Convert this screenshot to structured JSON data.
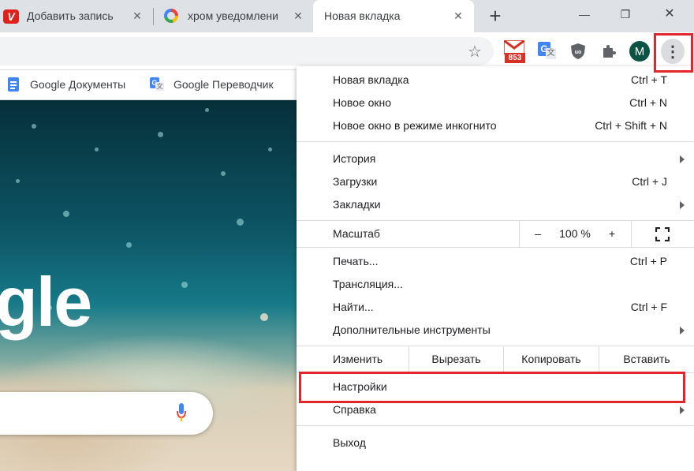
{
  "tabs": [
    {
      "title": "Добавить запись"
    },
    {
      "title": "хром уведомлени"
    },
    {
      "title": "Новая вкладка"
    }
  ],
  "new_tab_label": "+",
  "window_controls": {
    "minimize": "—",
    "maximize": "❐",
    "close": "✕"
  },
  "toolbar": {
    "gmail_badge": "853",
    "profile_initial": "M",
    "menu_icon": "⋮",
    "star_icon": "☆"
  },
  "bookmarks": [
    {
      "label": "Google Документы"
    },
    {
      "label": "Google Переводчик"
    }
  ],
  "page": {
    "logo_fragment": "gle"
  },
  "menu": {
    "group1": [
      {
        "label": "Новая вкладка",
        "shortcut": "Ctrl + T"
      },
      {
        "label": "Новое окно",
        "shortcut": "Ctrl + N"
      },
      {
        "label": "Новое окно в режиме инкогнито",
        "shortcut": "Ctrl + Shift + N"
      }
    ],
    "group2": [
      {
        "label": "История",
        "shortcut": ""
      },
      {
        "label": "Загрузки",
        "shortcut": "Ctrl + J"
      },
      {
        "label": "Закладки",
        "shortcut": ""
      }
    ],
    "zoom": {
      "label": "Масштаб",
      "minus": "–",
      "value": "100 %",
      "plus": "+"
    },
    "group3": [
      {
        "label": "Печать...",
        "shortcut": "Ctrl + P"
      },
      {
        "label": "Трансляция...",
        "shortcut": ""
      },
      {
        "label": "Найти...",
        "shortcut": "Ctrl + F"
      },
      {
        "label": "Дополнительные инструменты",
        "shortcut": ""
      }
    ],
    "edit": {
      "label": "Изменить",
      "cut": "Вырезать",
      "copy": "Копировать",
      "paste": "Вставить"
    },
    "settings": "Настройки",
    "help": "Справка",
    "exit": "Выход"
  },
  "colors": {
    "highlight": "#e3262d",
    "accent": "#1a73e8"
  }
}
